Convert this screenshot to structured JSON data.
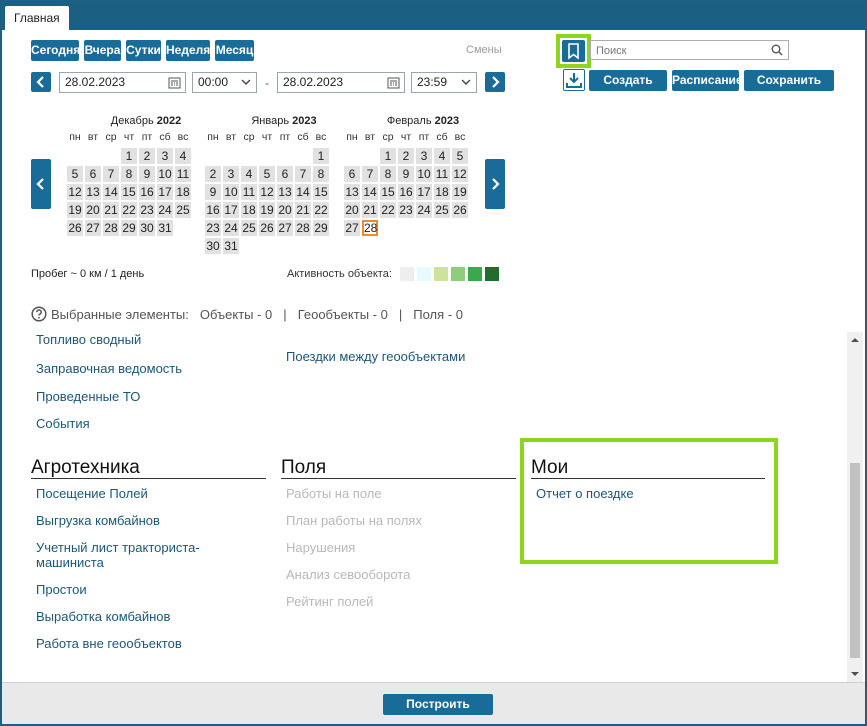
{
  "tabs": [
    {
      "label": "Главная"
    }
  ],
  "period_buttons": [
    "Сегодня",
    "Вчера",
    "Сутки",
    "Неделя",
    "Месяц"
  ],
  "shifts_label": "Смены",
  "search": {
    "placeholder": "Поиск"
  },
  "date_from": "28.02.2023",
  "time_from": "00:00",
  "date_to": "28.02.2023",
  "time_to": "23:59",
  "dash": "-",
  "actions": {
    "create": "Создать отчет",
    "schedule": "Расписание",
    "save": "Сохранить отчет"
  },
  "weekdays": [
    "пн",
    "вт",
    "ср",
    "чт",
    "пт",
    "сб",
    "вс"
  ],
  "calendars": [
    {
      "month": "Декабрь",
      "year": "2022",
      "offset": 3,
      "days": 31
    },
    {
      "month": "Январь",
      "year": "2023",
      "offset": 6,
      "days": 31
    },
    {
      "month": "Февраль",
      "year": "2023",
      "offset": 2,
      "days": 28,
      "selected": 28
    }
  ],
  "mileage": "Пробег ~ 0 км / 1 день",
  "activity_label": "Активность объекта:",
  "activity_colors": [
    "#eeeeee",
    "#e6fbff",
    "#cfe398",
    "#8fcc7c",
    "#3aa94d",
    "#1f6e2d"
  ],
  "selected": {
    "label": "Выбранные элементы:",
    "objects": "Объекты - 0",
    "sep1": "|",
    "geo": "Геообъекты - 0",
    "sep2": "|",
    "fields": "Поля - 0"
  },
  "col1_links": [
    "Топливо сводный",
    "Заправочная ведомость",
    "Проведенные ТО",
    "События"
  ],
  "col2_links": [
    "Поездки между геообъектами"
  ],
  "sections": {
    "agro": {
      "title": "Агротехника",
      "items": [
        "Посещение Полей",
        "Выгрузка комбайнов",
        "Учетный лист тракториста-машиниста",
        "Простои",
        "Выработка комбайнов",
        "Работа вне геообъектов"
      ]
    },
    "fields": {
      "title": "Поля",
      "items": [
        "Работы на поле",
        "План работы на полях",
        "Нарушения",
        "Анализ севооборота",
        "Рейтинг полей"
      ]
    },
    "mine": {
      "title": "Мои",
      "items": [
        "Отчет о поездке"
      ]
    }
  },
  "build_button": "Построить"
}
